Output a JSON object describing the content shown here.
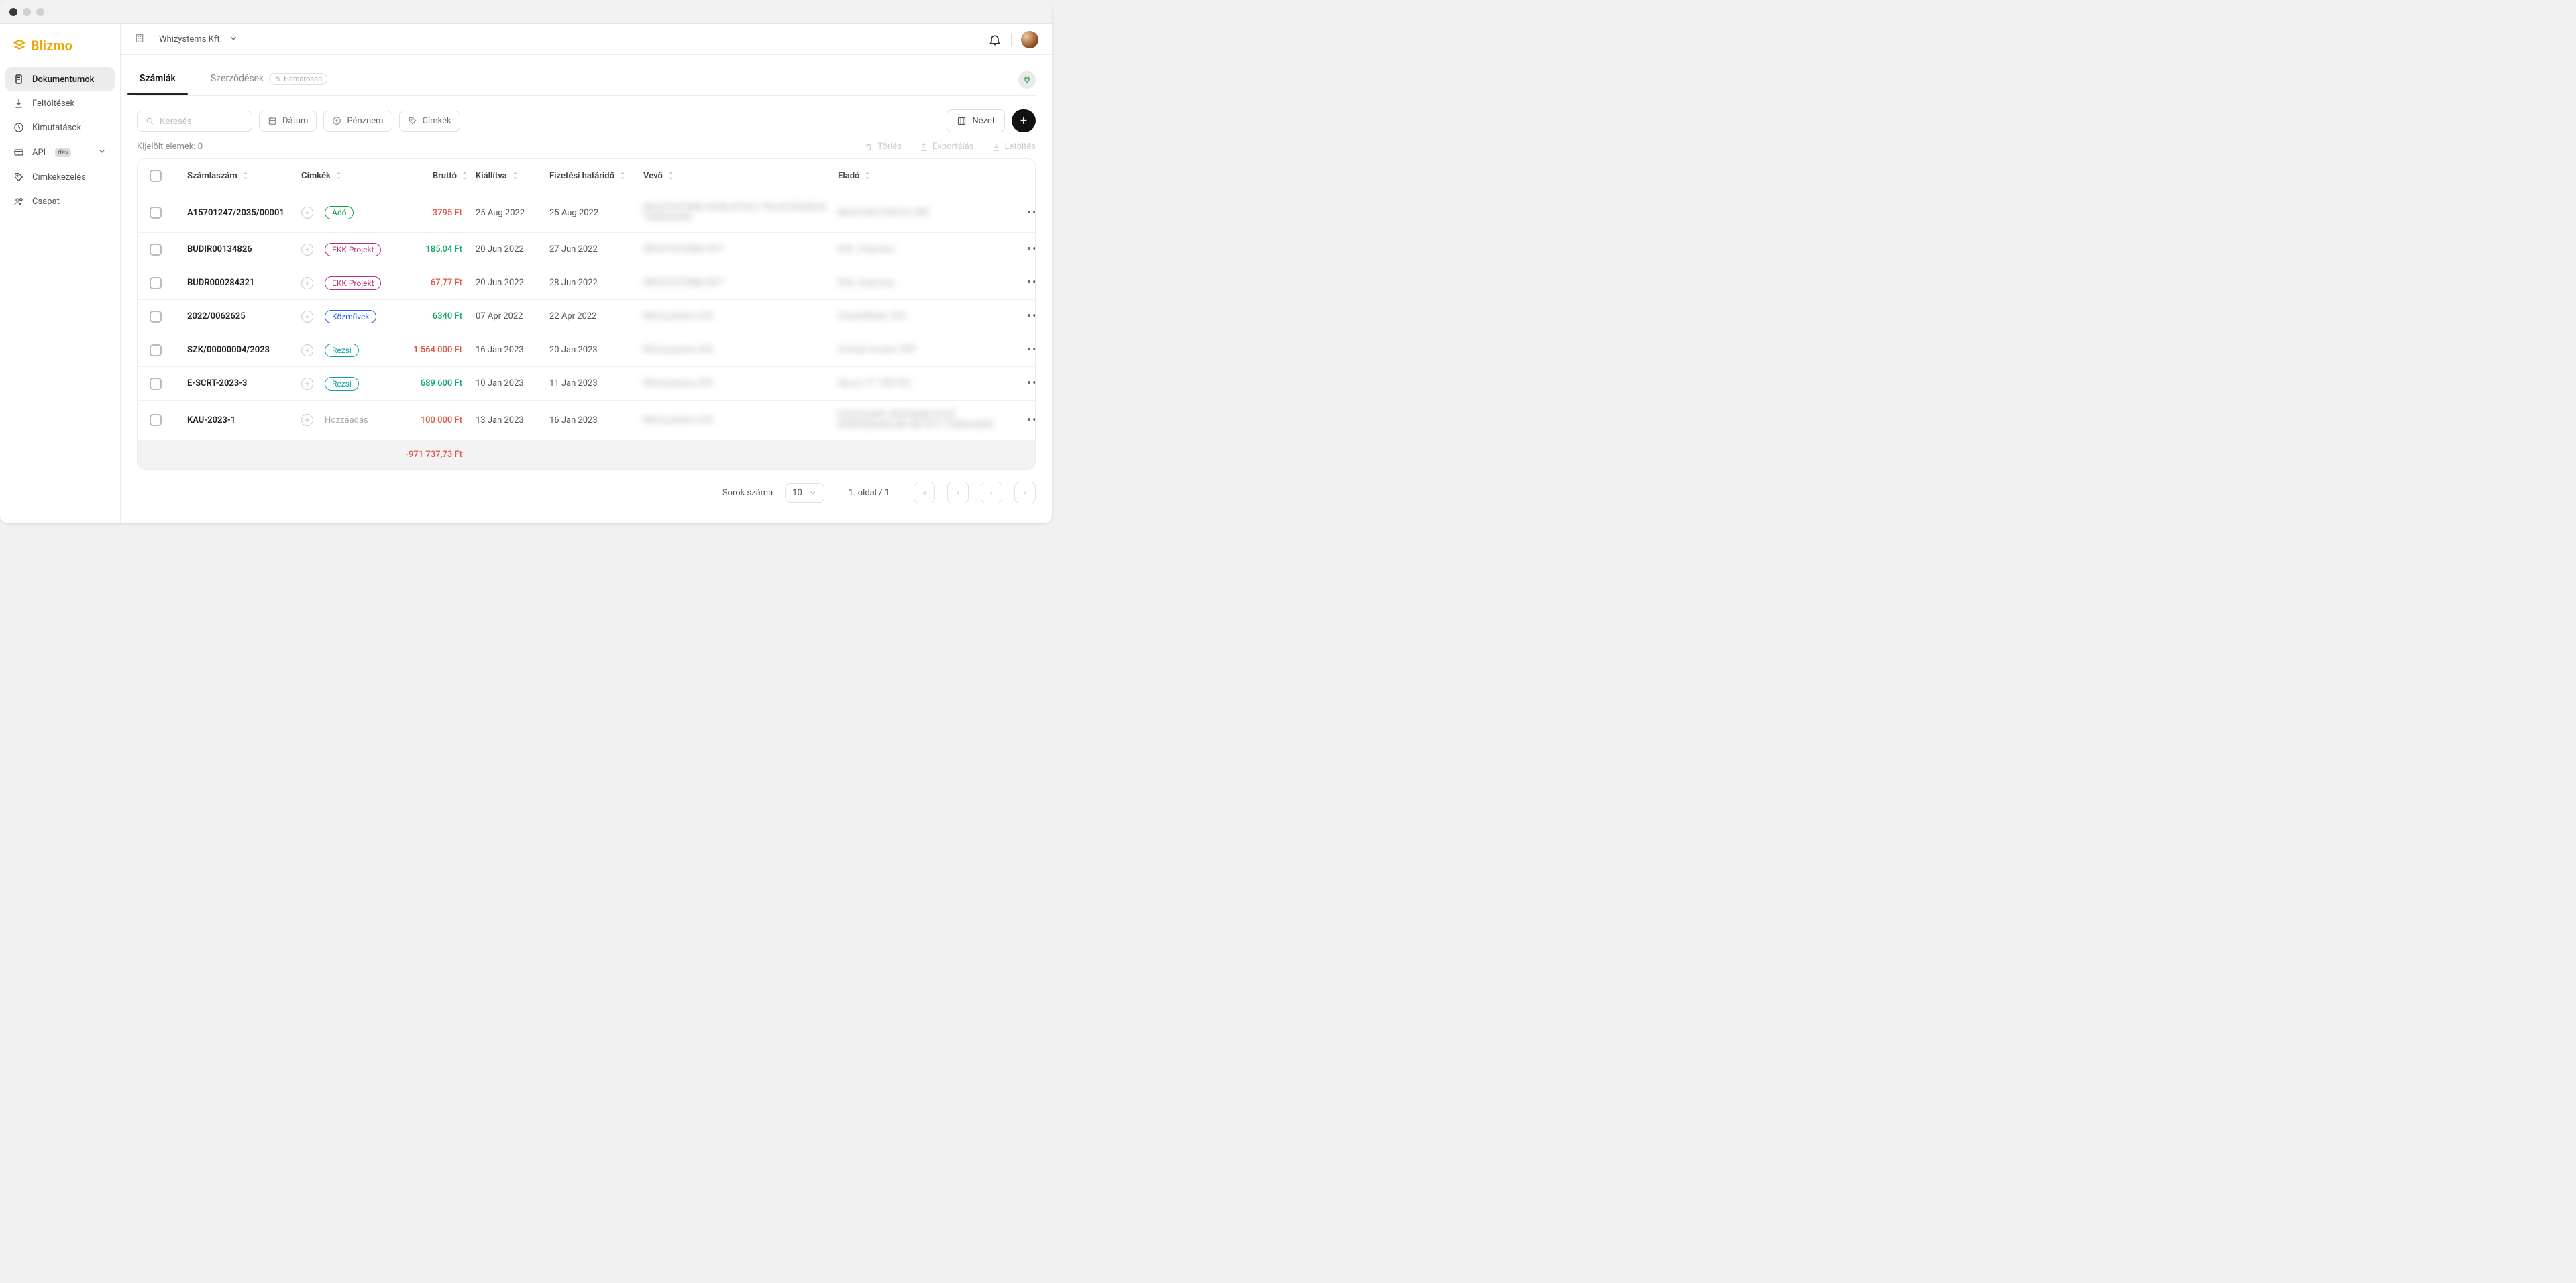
{
  "brand": "Blizmo",
  "company_name": "Whizystems Kft.",
  "sidebar": {
    "items": [
      {
        "label": "Dokumentumok",
        "active": true
      },
      {
        "label": "Feltöltések"
      },
      {
        "label": "Kimutatások"
      },
      {
        "label": "API",
        "badge": "dev",
        "expandable": true
      },
      {
        "label": "Címkekezelés"
      },
      {
        "label": "Csapat"
      }
    ]
  },
  "tabs": [
    {
      "label": "Számlák",
      "active": true
    },
    {
      "label": "Szerződések",
      "soon": "Hamarosan"
    }
  ],
  "filters": {
    "search_placeholder": "Keresés",
    "date": "Dátum",
    "currency": "Pénznem",
    "labels": "Címkék",
    "view_btn": "Nézet"
  },
  "selection_label": "Kijelölt elemek:",
  "selection_count": "0",
  "actions": {
    "delete": "Törlés",
    "export": "Exportálás",
    "download": "Letöltés"
  },
  "columns": {
    "szamlaszam": "Számlaszám",
    "cimkek": "Címkék",
    "brutto": "Bruttó",
    "kiallitva": "Kiállítva",
    "hatarido": "Fizetési határidő",
    "vevo": "Vevő",
    "elado": "Eladó"
  },
  "add_label_text": "Hozzáadás",
  "rows": [
    {
      "inv": "A15701247/2035/00001",
      "tags": [
        {
          "text": "Adó",
          "class": "green"
        }
      ],
      "brutto": "3795 Ft",
      "bclass": "red",
      "issued": "25 Aug 2022",
      "due": "25 Aug 2022",
      "buyer": "WHIZYSTEMS KORLÁTOLT FELELŐSSÉGŰ TÁRSASÁG",
      "seller": "MAGYAR POSTA ZRT"
    },
    {
      "inv": "BUDIR00134826",
      "tags": [
        {
          "text": "EKK Projekt",
          "class": "magenta"
        }
      ],
      "brutto": "185,04 Ft",
      "bclass": "green",
      "issued": "20 Jun 2022",
      "due": "27 Jun 2022",
      "buyer": "WHIZYSTEMS KFT",
      "seller": "DHL Express"
    },
    {
      "inv": "BUDR000284321",
      "tags": [
        {
          "text": "EKK Projekt",
          "class": "magenta"
        }
      ],
      "brutto": "67,77 Ft",
      "bclass": "red",
      "issued": "20 Jun 2022",
      "due": "28 Jun 2022",
      "buyer": "WHIZYSTEMS KFT",
      "seller": "DHL Express"
    },
    {
      "inv": "2022/0062625",
      "tags": [
        {
          "text": "Közművek",
          "class": "blue"
        }
      ],
      "brutto": "6340 Ft",
      "bclass": "green",
      "issued": "07 Apr 2022",
      "due": "22 Apr 2022",
      "buyer": "Whizystems Kft.",
      "seller": "CleanWater Kft."
    },
    {
      "inv": "SZK/00000004/2023",
      "tags": [
        {
          "text": "Rezsi",
          "class": "teal"
        }
      ],
      "brutto": "1 564 000 Ft",
      "bclass": "red",
      "issued": "16 Jan 2023",
      "due": "20 Jan 2023",
      "buyer": "Whizystems Kft.",
      "seller": "United Invest ZRT"
    },
    {
      "inv": "E-SCRT-2023-3",
      "tags": [
        {
          "text": "Rezsi",
          "class": "teal"
        }
      ],
      "brutto": "689 600 Ft",
      "bclass": "green",
      "issued": "10 Jan 2023",
      "due": "11 Jan 2023",
      "buyer": "Whizystems Kft.",
      "seller": "Secur-IT 100 Kft."
    },
    {
      "inv": "KAU-2023-1",
      "tags": [],
      "brutto": "100 000 Ft",
      "bclass": "red",
      "issued": "13 Jan 2023",
      "due": "16 Jan 2023",
      "buyer": "Whizystems Kft.",
      "seller": "KÖZSZAPP KÉPKERETEZŐ KERESKEDELMI BETÉTI TÁRSASÁG"
    }
  ],
  "summary_total": "-971 737,73 Ft",
  "pagination": {
    "rows_label": "Sorok száma",
    "rows_value": "10",
    "page_text": "1. oldal / 1"
  }
}
